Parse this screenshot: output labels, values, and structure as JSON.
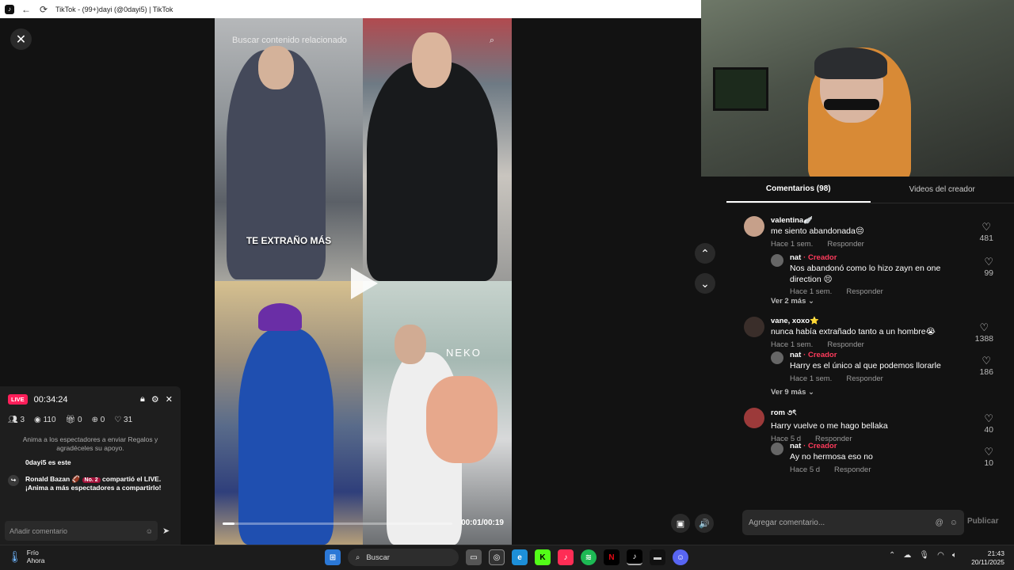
{
  "browser": {
    "tab_title": "TikTok - (99+)dayi (@0dayi5) | TikTok"
  },
  "video": {
    "search_placeholder": "Buscar contenido relacionado",
    "overlay_text": "TE EXTRAÑO MÁS",
    "watermark": "NEKO",
    "time": "00:01/00:19",
    "progress": 0.05
  },
  "comments_panel": {
    "tabs": [
      {
        "label": "Comentarios (98)",
        "active": true
      },
      {
        "label": "Videos del creador",
        "active": false
      }
    ],
    "comments": [
      {
        "name": "valentina🪽",
        "text": "me siento abandonada😔",
        "time": "Hace 1 sem.",
        "reply": "Responder",
        "likes": "481",
        "replies": [
          {
            "name": "nat",
            "badge": "Creador",
            "text": "Nos abandonó como lo hizo zayn en one direction 😣",
            "time": "Hace 1 sem.",
            "reply": "Responder",
            "likes": "99"
          }
        ],
        "more": "Ver 2 más"
      },
      {
        "name": "vane, xoxo⭐",
        "text": "nunca había extrañado tanto a un hombre😭",
        "time": "Hace 1 sem.",
        "reply": "Responder",
        "likes": "1388",
        "replies": [
          {
            "name": "nat",
            "badge": "Creador",
            "text": "Harry es el único al que podemos llorarle",
            "time": "Hace 1 sem.",
            "reply": "Responder",
            "likes": "186"
          }
        ],
        "more": "Ver 9 más"
      },
      {
        "name": "rom ૭ৎ",
        "text": "Harry vuelve o me hago bellaka",
        "time": "Hace 5 d",
        "reply": "Responder",
        "likes": "40",
        "replies": [
          {
            "name": "nat",
            "badge": "Creador",
            "text": "Ay no hermosa eso no",
            "time": "Hace 5 d",
            "reply": "Responder",
            "likes": "10"
          }
        ]
      }
    ],
    "add_comment_placeholder": "Agregar comentario...",
    "publish_label": "Publicar"
  },
  "live": {
    "badge": "LIVE",
    "timer": "00:34:24",
    "stats": {
      "viewers": "3",
      "views": "110",
      "gifts": "0",
      "follows": "0",
      "likes": "31"
    },
    "hint": "Anima a los espectadores a enviar Regalos y agradéceles su apoyo.",
    "msg1": "0dayi5 es este",
    "msg2_user": "Ronald Bazan 🏈",
    "msg2_rank": "No. 2",
    "msg2_text": "compartió el LIVE. ¡Anima a más espectadores a compartirlo!",
    "input_placeholder": "Añadir comentario"
  },
  "taskbar": {
    "weather_temp": "Frío",
    "weather_sub": "Ahora",
    "search": "Buscar",
    "time": "21:43",
    "date": "20/11/2025"
  }
}
